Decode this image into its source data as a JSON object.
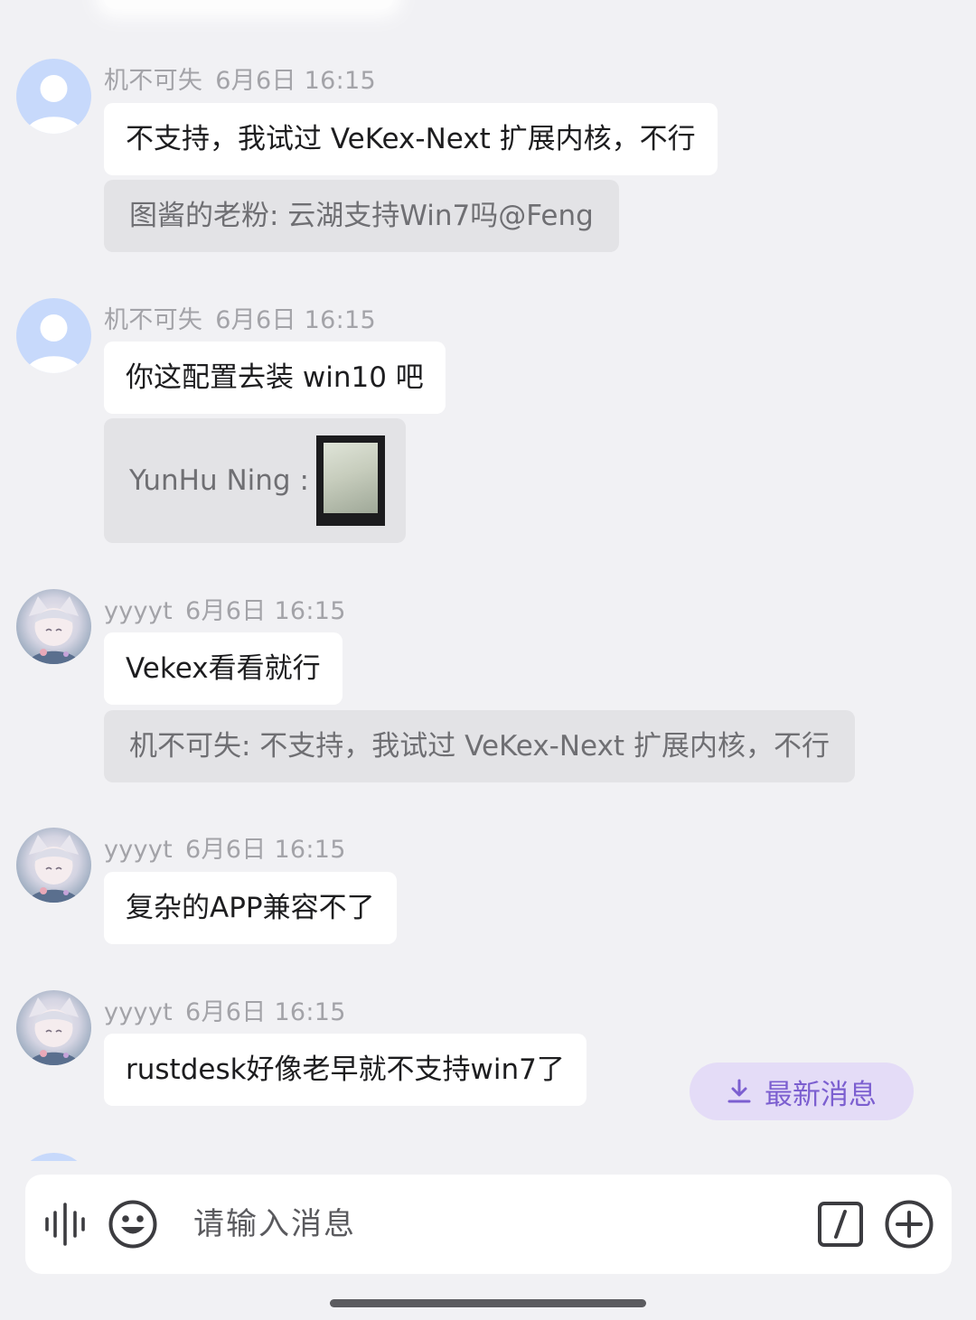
{
  "messages": [
    {
      "sender": "机不可失",
      "time": "6月6日 16:15",
      "text": "不支持，我试过 VeKex-Next 扩展内核，不行",
      "quote": "图酱的老粉: 云湖支持Win7吗@Feng"
    },
    {
      "sender": "机不可失",
      "time": "6月6日 16:15",
      "text": "你这配置去装 win10 吧",
      "quote_sender": "YunHu Ning :"
    },
    {
      "sender": "yyyyt",
      "time": "6月6日 16:15",
      "text": "Vekex看看就行",
      "quote": "机不可失: 不支持，我试过 VeKex-Next 扩展内核，不行"
    },
    {
      "sender": "yyyyt",
      "time": "6月6日 16:15",
      "text": "复杂的APP兼容不了"
    },
    {
      "sender": "yyyyt",
      "time": "6月6日 16:15",
      "text": "rustdesk好像老早就不支持win7了"
    }
  ],
  "jump_to_latest": {
    "label": "最新消息",
    "icon": "download-arrow-icon"
  },
  "input": {
    "placeholder": "请输入消息",
    "voice_icon": "voice-wave-icon",
    "emoji_icon": "emoji-icon",
    "command_icon": "slash-command-icon",
    "add_icon": "plus-circle-icon"
  },
  "colors": {
    "background": "#f1f1f4",
    "bubble": "#ffffff",
    "quote_bubble": "#e3e3e6",
    "accent": "#7c5fd0",
    "accent_bg": "#e4dcf7"
  }
}
